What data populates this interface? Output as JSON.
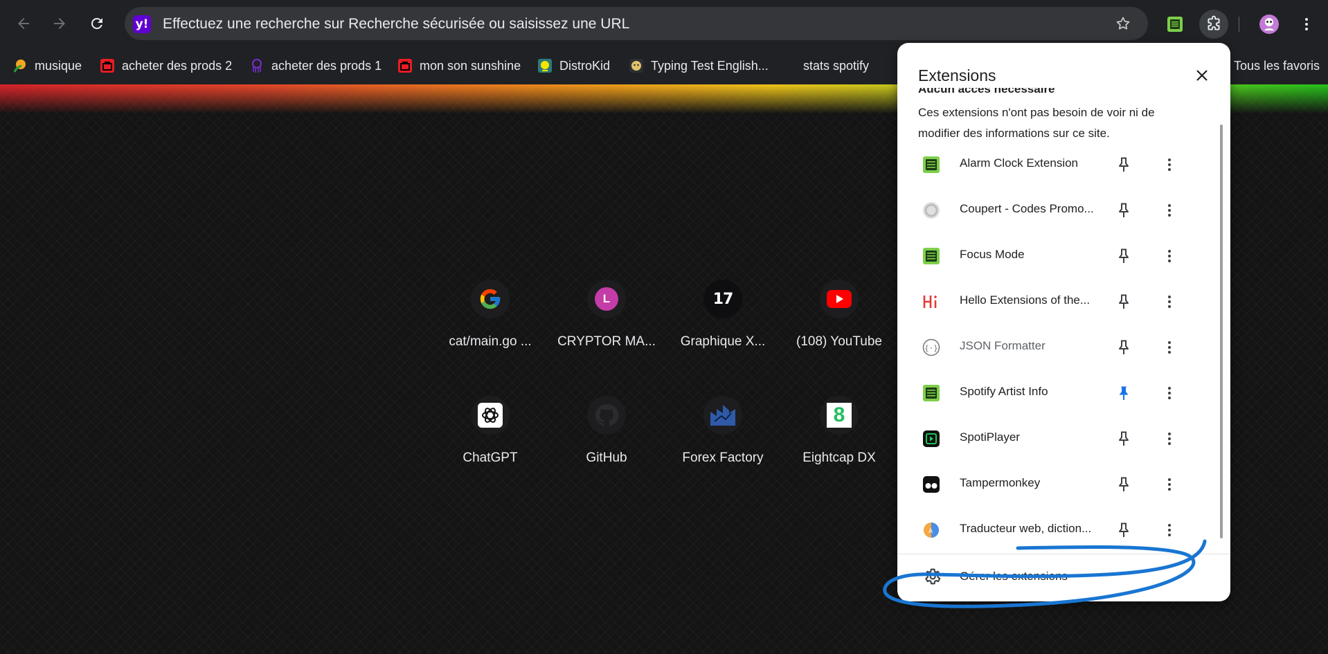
{
  "omnibox": {
    "text": "Effectuez une recherche sur Recherche sécurisée ou saisissez une URL",
    "badge": "y!"
  },
  "bookmarks": [
    {
      "label": "musique",
      "icon": "orange-leaf-icon",
      "color": "#f5a623"
    },
    {
      "label": "acheter des prods 2",
      "icon": "red-bag-icon",
      "color": "#e81c24"
    },
    {
      "label": "acheter des prods 1",
      "icon": "purple-octopus-icon",
      "color": "#7b2bd6"
    },
    {
      "label": "mon son sunshine",
      "icon": "red-bag-icon",
      "color": "#e81c24"
    },
    {
      "label": "DistroKid",
      "icon": "distrokid-icon",
      "color": "#f7e400"
    },
    {
      "label": "Typing Test English...",
      "icon": "monkey-icon",
      "color": "#e0c36a"
    },
    {
      "label": "stats spotify",
      "icon": "none",
      "color": "#202124"
    },
    {
      "label": "Tous les favoris",
      "icon": "folder-icon",
      "color": "#f3b21c"
    }
  ],
  "shortcuts": [
    {
      "label": "cat/main.go ...",
      "icon": "google-icon"
    },
    {
      "label": "CRYPTOR MA...",
      "icon": "letter-l-icon",
      "letter": "L"
    },
    {
      "label": "Graphique X...",
      "icon": "tradingview-icon",
      "letter": "17"
    },
    {
      "label": "(108) YouTube",
      "icon": "youtube-icon"
    },
    {
      "label": "ChatGPT",
      "icon": "chatgpt-icon"
    },
    {
      "label": "GitHub",
      "icon": "github-icon"
    },
    {
      "label": "Forex Factory",
      "icon": "forex-factory-icon"
    },
    {
      "label": "Eightcap DX",
      "icon": "eightcap-icon",
      "letter": "8"
    }
  ],
  "extensions_popup": {
    "title": "Extensions",
    "section_heading": "Aucun accès nécessaire",
    "section_description": "Ces extensions n'ont pas besoin de voir ni de modifier des informations sur ce site.",
    "items": [
      {
        "name": "Alarm Clock Extension",
        "icon": "green-screen-icon",
        "pinned": false
      },
      {
        "name": "Coupert - Codes Promo...",
        "icon": "coupert-icon",
        "pinned": false
      },
      {
        "name": "Focus Mode",
        "icon": "green-screen-icon",
        "pinned": false
      },
      {
        "name": "Hello Extensions of the...",
        "icon": "hello-hi-icon",
        "pinned": false
      },
      {
        "name": "JSON Formatter",
        "icon": "json-braces-icon",
        "pinned": false
      },
      {
        "name": "Spotify Artist Info",
        "icon": "green-screen-icon",
        "pinned": true
      },
      {
        "name": "SpotiPlayer",
        "icon": "spotiplayer-icon",
        "pinned": false
      },
      {
        "name": "Tampermonkey",
        "icon": "tampermonkey-icon",
        "pinned": false
      },
      {
        "name": "Traducteur web, diction...",
        "icon": "translator-globe-icon",
        "pinned": false
      }
    ],
    "manage_label": "Gérer les extensions"
  },
  "colors": {
    "toolbar": "#202124",
    "omnibox": "#35363a",
    "pinned": "#1a73e8",
    "annotation": "#1976d2"
  }
}
